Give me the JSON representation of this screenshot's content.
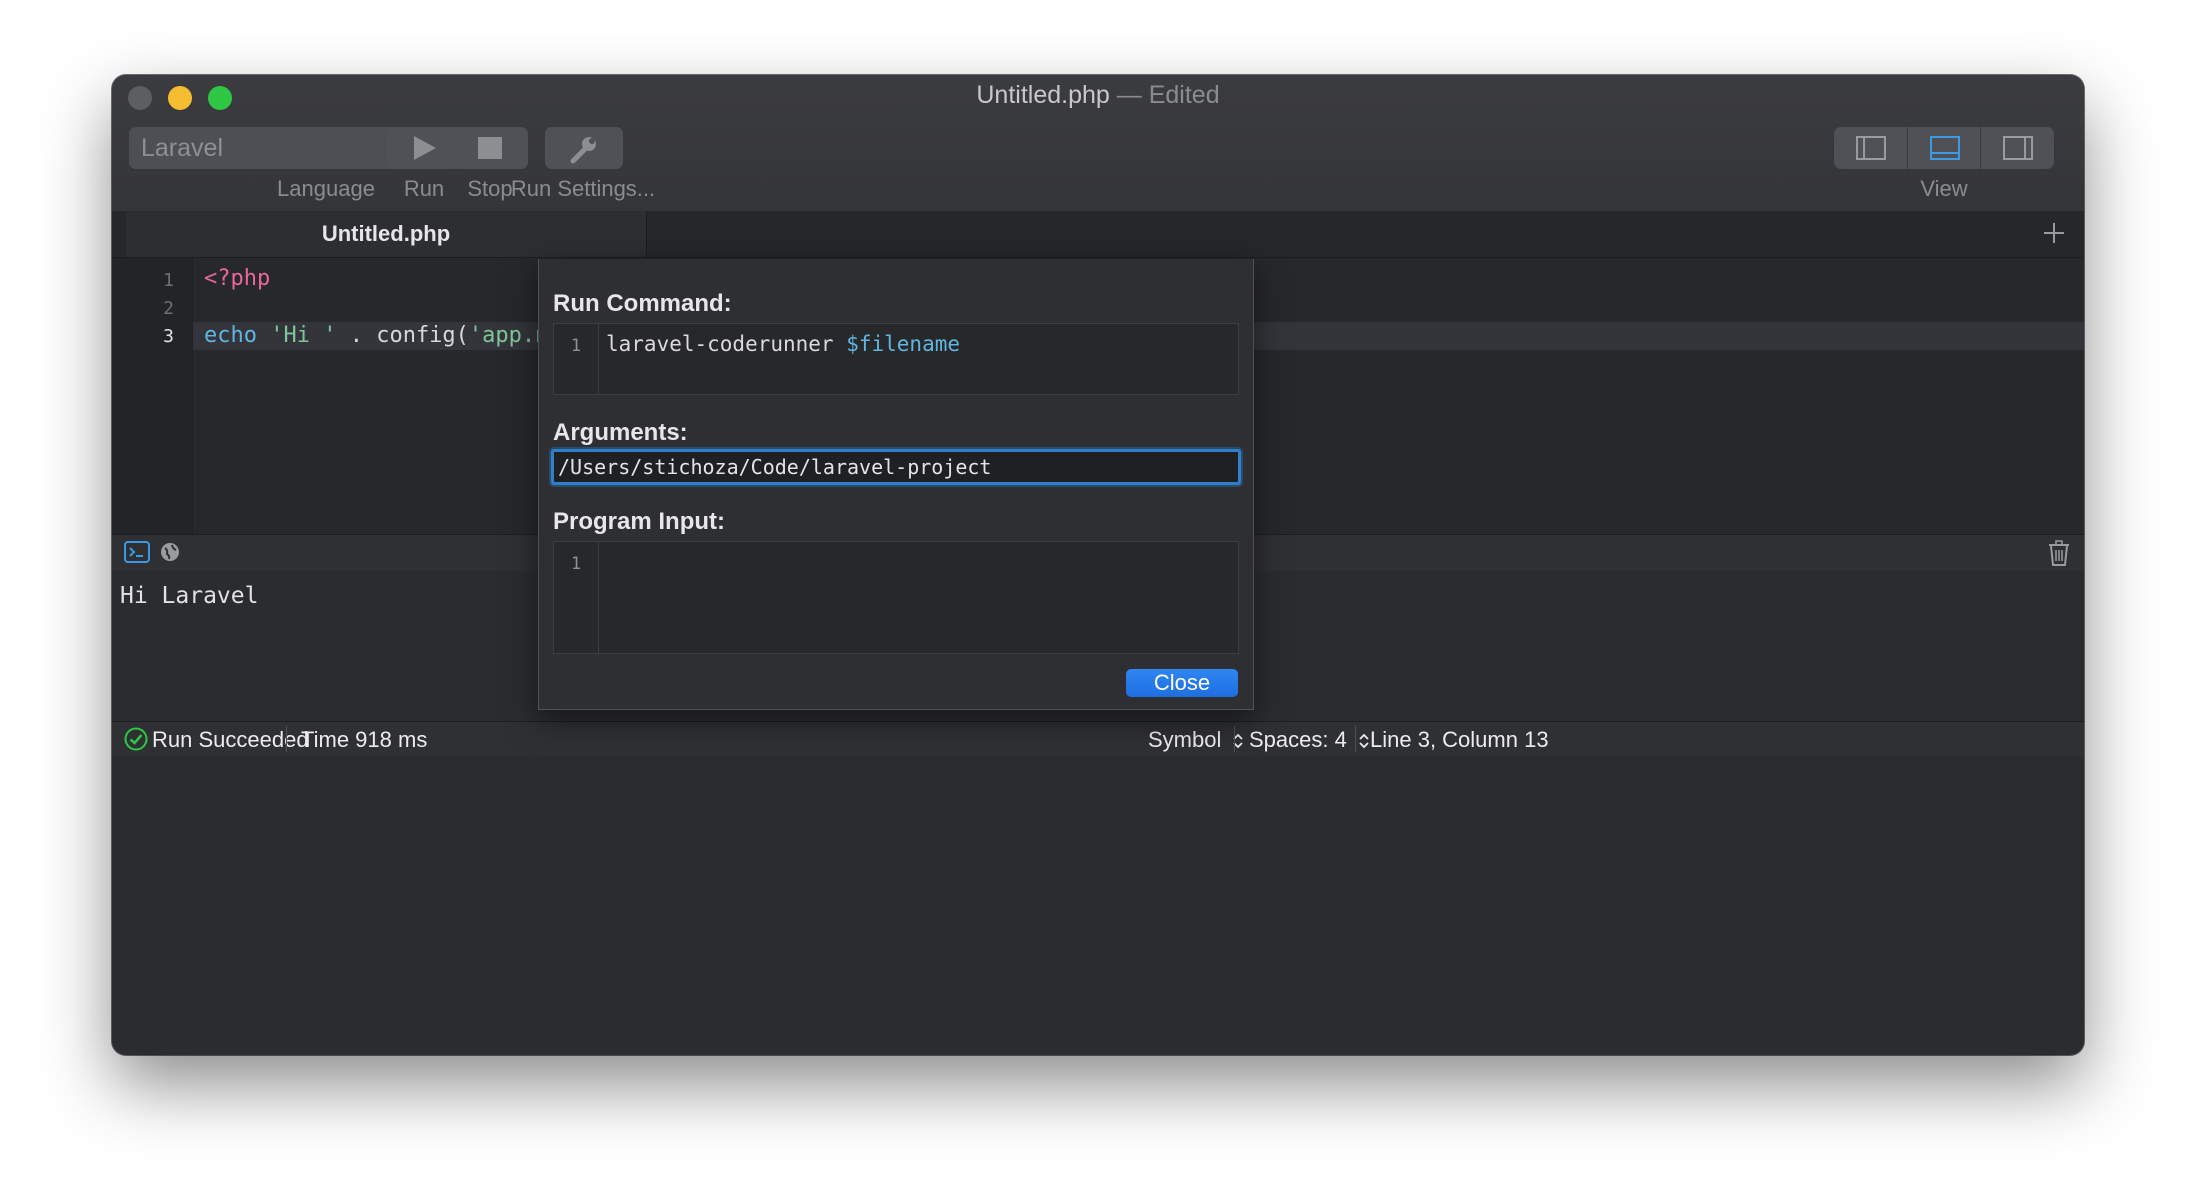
{
  "window": {
    "title_file": "Untitled.php",
    "title_separator": "—",
    "title_state": "Edited"
  },
  "toolbar": {
    "language_value": "Laravel",
    "language_label": "Language",
    "run_label": "Run",
    "stop_label": "Stop",
    "run_settings_label": "Run Settings...",
    "view_label": "View"
  },
  "tabs": [
    {
      "label": "Untitled.php"
    }
  ],
  "editor": {
    "line_numbers": [
      "1",
      "2",
      "3"
    ],
    "line1": "<?php",
    "line3_keyword": "echo",
    "line3_string": "'Hi '",
    "line3_rest": " . config(",
    "line3_string2": "'app.na"
  },
  "console": {
    "output": "Hi Laravel"
  },
  "status_bar": {
    "run_status": "Run Succeeded",
    "time": "Time 918 ms",
    "symbol": "Symbol",
    "spaces": "Spaces: 4",
    "position": "Line 3, Column 13"
  },
  "run_settings_sheet": {
    "run_command_label": "Run Command:",
    "run_command_line_number": "1",
    "run_command_text": "laravel-coderunner ",
    "run_command_var": "$filename",
    "arguments_label": "Arguments:",
    "arguments_value": "/Users/stichoza/Code/laravel-project",
    "program_input_label": "Program Input:",
    "program_input_line_number": "1",
    "close_label": "Close"
  },
  "colors": {
    "accent": "#2f7fcf",
    "success": "#2fc643",
    "tag": "#e9679a",
    "keyword": "#5fb6e2",
    "string": "#7fc79a"
  },
  "icons": {
    "run": "play-icon",
    "stop": "stop-icon",
    "run_settings": "wrench-icon",
    "console": "terminal-icon",
    "web": "globe-icon",
    "clear": "trash-icon",
    "status": "checkmark-icon"
  }
}
